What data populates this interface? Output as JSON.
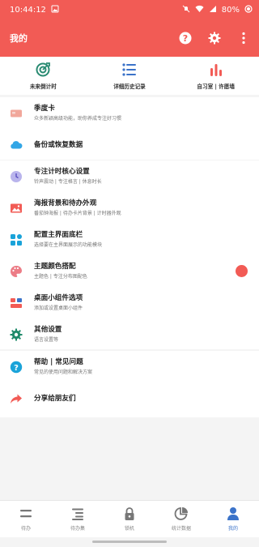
{
  "status": {
    "time": "10:44:12",
    "battery": "80%"
  },
  "appbar": {
    "title": "我的"
  },
  "quick": [
    {
      "label": "未来倒计时",
      "icon": "target-icon"
    },
    {
      "label": "详细历史记录",
      "icon": "history-list-icon"
    },
    {
      "label": "自习室 | 许愿墙",
      "icon": "bar-chart-icon"
    }
  ],
  "group1": [
    {
      "title": "季度卡",
      "sub": "众多新颖高级功能，助你养成专注好习惯",
      "icon": "card-icon"
    },
    {
      "title": "备份或恢复数据",
      "sub": "",
      "icon": "cloud-icon"
    }
  ],
  "group2": [
    {
      "title": "专注计时核心设置",
      "sub": "铃声震动 | 专注格言 | 休息时长",
      "icon": "clock-icon"
    },
    {
      "title": "海报背景和待办外观",
      "sub": "番茄钟海报 | 待办卡片背景 | 计时器外观",
      "icon": "image-icon"
    },
    {
      "title": "配置主界面底栏",
      "sub": "选择要在主界面展示的功能模块",
      "icon": "grid-icon"
    },
    {
      "title": "主题颜色搭配",
      "sub": "主题色 | 专注分布图配色",
      "icon": "palette-icon"
    },
    {
      "title": "桌面小组件选项",
      "sub": "添加或设置桌面小组件",
      "icon": "widget-icon"
    },
    {
      "title": "其他设置",
      "sub": "语言设置等",
      "icon": "settings-icon"
    }
  ],
  "group3": [
    {
      "title": "帮助 | 常见问题",
      "sub": "常见的使用问题和解决方案",
      "icon": "help-icon"
    },
    {
      "title": "分享给朋友们",
      "sub": "",
      "icon": "share-icon"
    }
  ],
  "tabs": [
    {
      "label": "待办",
      "icon": "todo-icon"
    },
    {
      "label": "待办集",
      "icon": "todo-set-icon"
    },
    {
      "label": "锁机",
      "icon": "lock-icon"
    },
    {
      "label": "统计数据",
      "icon": "pie-chart-icon"
    },
    {
      "label": "我的",
      "icon": "person-icon"
    }
  ],
  "colors": {
    "brand": "#f25b55",
    "active_tab": "#3b73c9"
  }
}
